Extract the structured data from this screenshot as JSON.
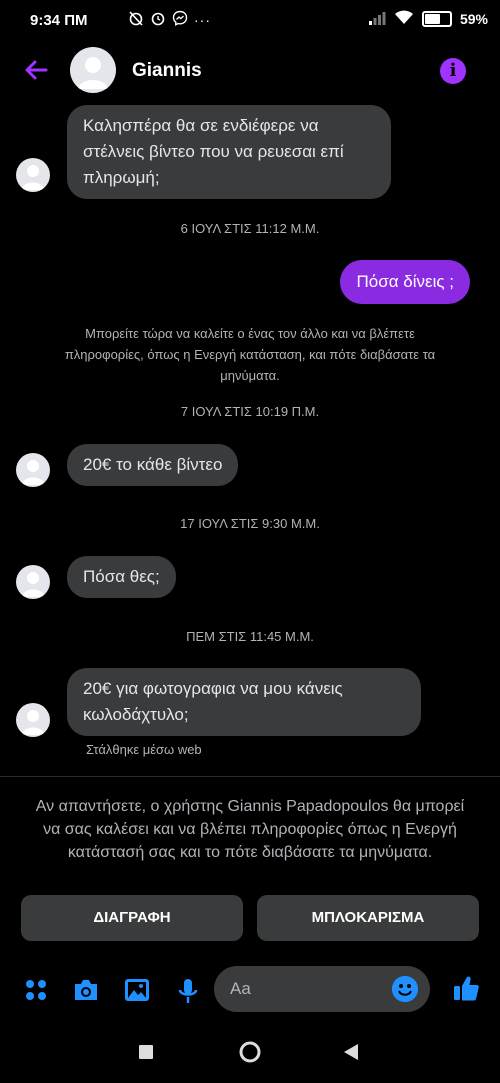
{
  "status": {
    "time": "9:34 ΠΜ",
    "battery": "59%",
    "battery_level": 0.59
  },
  "header": {
    "title": "Giannis",
    "back_icon": "arrow-left-icon",
    "info_icon": "info-icon",
    "info_glyph": "i"
  },
  "messages": [
    {
      "type": "incoming",
      "text": "Καλησπέρα θα σε ενδιέφερε να στέλνεις βίντεο που να ρευεσαι επί πληρωμή;"
    },
    {
      "type": "timestamp",
      "text": "6 ΙΟΥΛ ΣΤΙΣ 11:12 Μ.Μ."
    },
    {
      "type": "outgoing",
      "text": "Πόσα δίνεις ;"
    },
    {
      "type": "notice",
      "text": "Μπορείτε τώρα να καλείτε ο ένας τον άλλο και να βλέπετε πληροφορίες, όπως η Ενεργή κατάσταση, και πότε διαβάσατε τα μηνύματα."
    },
    {
      "type": "timestamp",
      "text": "7 ΙΟΥΛ ΣΤΙΣ 10:19 Π.Μ."
    },
    {
      "type": "incoming",
      "text": "20€ το κάθε βίντεο"
    },
    {
      "type": "timestamp",
      "text": "17 ΙΟΥΛ ΣΤΙΣ 9:30 Μ.Μ."
    },
    {
      "type": "incoming",
      "text": "Πόσα θες;"
    },
    {
      "type": "timestamp",
      "text": "ΠΕΜ ΣΤΙΣ 11:45 Μ.Μ."
    },
    {
      "type": "incoming",
      "text": "20€ για φωτογραφια να μου κάνεις κωλοδάχτυλο;"
    }
  ],
  "sent_via": "Στάλθηκε μέσω web",
  "request": {
    "text": "Αν απαντήσετε, ο χρήστης Giannis Papadopoulos θα μπορεί να σας καλέσει και να βλέπει πληροφορίες όπως η Ενεργή κατάστασή σας και το πότε διαβάσατε τα μηνύματα.",
    "delete_label": "ΔΙΑΓΡΑΦΗ",
    "block_label": "ΜΠΛΟΚΑΡΙΣΜΑ"
  },
  "composer": {
    "placeholder": "Aa",
    "icons": [
      "apps-icon",
      "camera-icon",
      "image-icon",
      "microphone-icon",
      "emoji-icon",
      "thumbs-up-icon"
    ]
  },
  "colors": {
    "accent": "#a033ff",
    "outgoing_bubble": "#8a2be2",
    "incoming_bubble": "#3a3b3c",
    "icon_blue": "#1e90ff"
  }
}
